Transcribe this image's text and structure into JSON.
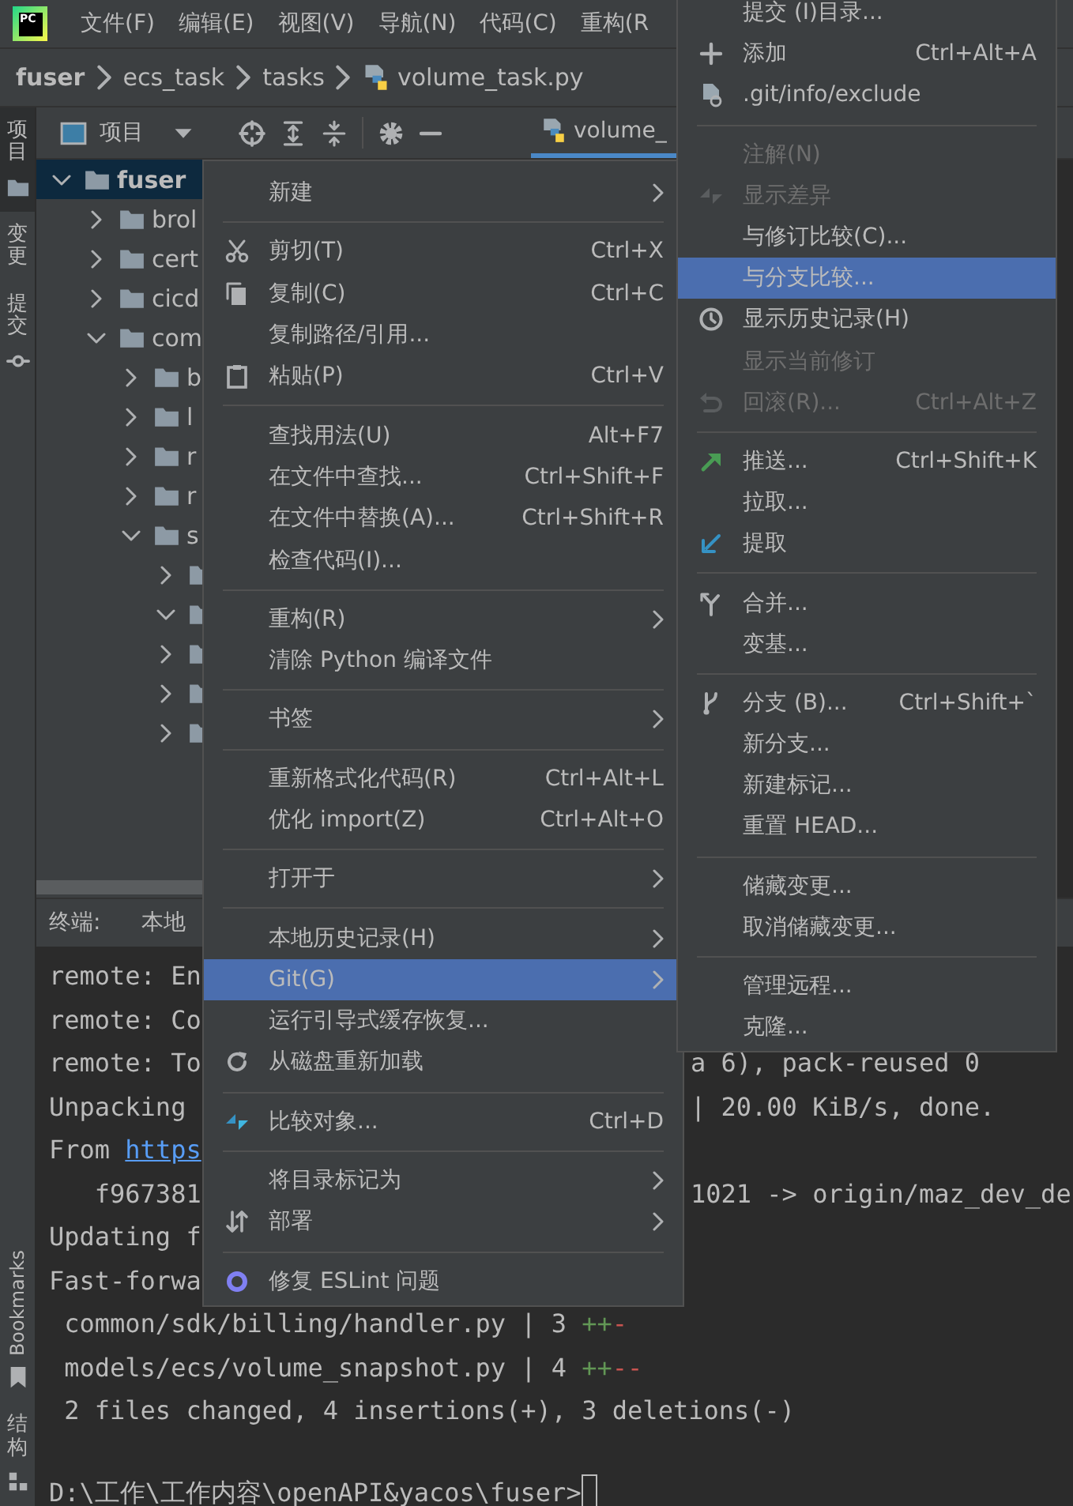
{
  "logo": "PC",
  "menu_bar": [
    "文件(F)",
    "编辑(E)",
    "视图(V)",
    "导航(N)",
    "代码(C)",
    "重构(R"
  ],
  "breadcrumb": [
    {
      "label": "fuser",
      "kind": "root"
    },
    {
      "label": "ecs_task",
      "kind": "folder"
    },
    {
      "label": "tasks",
      "kind": "folder"
    },
    {
      "label": "volume_task.py",
      "kind": "python"
    }
  ],
  "tool_strip": {
    "top": [
      {
        "label": "项目",
        "selected": true
      },
      {
        "label": "变更",
        "selected": false
      },
      {
        "label": "提交",
        "selected": false
      }
    ],
    "bottom": [
      {
        "label": "Bookmarks",
        "kind": "latin"
      },
      {
        "label": "结构",
        "kind": "cjk"
      }
    ]
  },
  "project_panel": {
    "title": "项目",
    "tree": [
      {
        "label": "fuser",
        "expanded": true,
        "selected": true,
        "children": [
          {
            "label": "brol",
            "expanded": false,
            "selected": false
          },
          {
            "label": "cert",
            "expanded": false,
            "selected": false
          },
          {
            "label": "cicd",
            "expanded": false,
            "selected": false
          },
          {
            "label": "com",
            "expanded": true,
            "selected": false,
            "children": [
              {
                "label": "b",
                "expanded": false,
                "selected": false
              },
              {
                "label": "l",
                "expanded": false,
                "selected": false
              },
              {
                "label": "r",
                "expanded": false,
                "selected": false
              },
              {
                "label": "r",
                "expanded": false,
                "selected": false
              },
              {
                "label": "s",
                "expanded": true,
                "selected": false,
                "children": [
                  {
                    "expanded": false,
                    "selected": false
                  },
                  {
                    "expanded": true,
                    "selected": false
                  },
                  {
                    "expanded": false,
                    "selected": false
                  },
                  {
                    "expanded": false,
                    "selected": false
                  },
                  {
                    "expanded": false,
                    "selected": false
                  }
                ]
              }
            ]
          }
        ]
      }
    ]
  },
  "editor_tab": {
    "label": "volume_",
    "selected": true
  },
  "terminal": {
    "title": "终端:",
    "tabs": [
      {
        "label": "本地"
      }
    ],
    "lines": [
      {
        "kind": "output",
        "text": "remote: En"
      },
      {
        "kind": "output",
        "text": "remote: Co"
      },
      {
        "kind": "output",
        "text": "remote: To",
        "right": "a 6), pack-reused 0"
      },
      {
        "kind": "output",
        "text": "Unpacking",
        "right": "| 20.00 KiB/s, done."
      },
      {
        "kind": "output",
        "text": "From ",
        "link": "https"
      },
      {
        "kind": "output",
        "text": "   f967381",
        "right": "1021 -> origin/maz_dev_de"
      },
      {
        "kind": "output",
        "text": "Updating f"
      },
      {
        "kind": "output",
        "text": "Fast-forwa"
      },
      {
        "kind": "output",
        "text": " common/sdk/billing/handler.py | 3 ",
        "plus": "++",
        "minus": "-"
      },
      {
        "kind": "output",
        "text": " models/ecs/volume_snapshot.py | 4 ",
        "plus": "++",
        "minus": "--"
      },
      {
        "kind": "output",
        "text": " 2 files changed, 4 insertions(+), 3 deletions(-)"
      },
      {
        "kind": "prompt",
        "text": "D:\\工作\\工作内容\\openAPI&yacos\\fuser>"
      }
    ]
  },
  "context_menu": {
    "items": [
      {
        "kind": "item",
        "label": "新建",
        "submenu": true,
        "selected": false
      },
      {
        "kind": "separator"
      },
      {
        "kind": "item",
        "label": "剪切(T)",
        "shortcut": "Ctrl+X",
        "selected": false
      },
      {
        "kind": "item",
        "label": "复制(C)",
        "shortcut": "Ctrl+C",
        "selected": false
      },
      {
        "kind": "item",
        "label": "复制路径/引用...",
        "selected": false
      },
      {
        "kind": "item",
        "label": "粘贴(P)",
        "shortcut": "Ctrl+V",
        "selected": false
      },
      {
        "kind": "separator"
      },
      {
        "kind": "item",
        "label": "查找用法(U)",
        "shortcut": "Alt+F7",
        "selected": false
      },
      {
        "kind": "item",
        "label": "在文件中查找...",
        "shortcut": "Ctrl+Shift+F",
        "selected": false
      },
      {
        "kind": "item",
        "label": "在文件中替换(A)...",
        "shortcut": "Ctrl+Shift+R",
        "selected": false
      },
      {
        "kind": "item",
        "label": "检查代码(I)...",
        "selected": false
      },
      {
        "kind": "separator"
      },
      {
        "kind": "item",
        "label": "重构(R)",
        "submenu": true,
        "selected": false
      },
      {
        "kind": "item",
        "label": "清除 Python 编译文件",
        "selected": false
      },
      {
        "kind": "separator"
      },
      {
        "kind": "item",
        "label": "书签",
        "submenu": true,
        "selected": false
      },
      {
        "kind": "separator"
      },
      {
        "kind": "item",
        "label": "重新格式化代码(R)",
        "shortcut": "Ctrl+Alt+L",
        "selected": false
      },
      {
        "kind": "item",
        "label": "优化 import(Z)",
        "shortcut": "Ctrl+Alt+O",
        "selected": false
      },
      {
        "kind": "separator"
      },
      {
        "kind": "item",
        "label": "打开于",
        "submenu": true,
        "selected": false
      },
      {
        "kind": "separator"
      },
      {
        "kind": "item",
        "label": "本地历史记录(H)",
        "submenu": true,
        "selected": false
      },
      {
        "kind": "item",
        "label": "Git(G)",
        "submenu": true,
        "selected": true
      },
      {
        "kind": "item",
        "label": "运行引导式缓存恢复...",
        "selected": false
      },
      {
        "kind": "item",
        "label": "从磁盘重新加载",
        "selected": false
      },
      {
        "kind": "separator"
      },
      {
        "kind": "item",
        "label": "比较对象...",
        "shortcut": "Ctrl+D",
        "selected": false
      },
      {
        "kind": "separator"
      },
      {
        "kind": "item",
        "label": "将目录标记为",
        "submenu": true,
        "selected": false
      },
      {
        "kind": "item",
        "label": "部署",
        "submenu": true,
        "selected": false
      },
      {
        "kind": "separator"
      },
      {
        "kind": "item",
        "label": "修复 ESLint 问题",
        "selected": false
      }
    ]
  },
  "git_submenu": {
    "items": [
      {
        "kind": "item",
        "label": "提交 (I)目录...",
        "selected": false,
        "disabled": false
      },
      {
        "kind": "item",
        "label": "添加",
        "shortcut": "Ctrl+Alt+A",
        "selected": false,
        "disabled": false
      },
      {
        "kind": "item",
        "label": ".git/info/exclude",
        "selected": false,
        "disabled": false
      },
      {
        "kind": "separator"
      },
      {
        "kind": "item",
        "label": "注解(N)",
        "selected": false,
        "disabled": true
      },
      {
        "kind": "item",
        "label": "显示差异",
        "selected": false,
        "disabled": true
      },
      {
        "kind": "item",
        "label": "与修订比较(C)...",
        "selected": false,
        "disabled": false
      },
      {
        "kind": "item",
        "label": "与分支比较...",
        "selected": true,
        "disabled": false
      },
      {
        "kind": "item",
        "label": "显示历史记录(H)",
        "selected": false,
        "disabled": false
      },
      {
        "kind": "item",
        "label": "显示当前修订",
        "selected": false,
        "disabled": true
      },
      {
        "kind": "item",
        "label": "回滚(R)...",
        "shortcut": "Ctrl+Alt+Z",
        "selected": false,
        "disabled": true
      },
      {
        "kind": "separator"
      },
      {
        "kind": "item",
        "label": "推送...",
        "shortcut": "Ctrl+Shift+K",
        "selected": false,
        "disabled": false
      },
      {
        "kind": "item",
        "label": "拉取...",
        "selected": false,
        "disabled": false
      },
      {
        "kind": "item",
        "label": "提取",
        "selected": false,
        "disabled": false
      },
      {
        "kind": "separator"
      },
      {
        "kind": "item",
        "label": "合并...",
        "selected": false,
        "disabled": false
      },
      {
        "kind": "item",
        "label": "变基...",
        "selected": false,
        "disabled": false
      },
      {
        "kind": "separator"
      },
      {
        "kind": "item",
        "label": "分支 (B)...",
        "shortcut": "Ctrl+Shift+`",
        "selected": false,
        "disabled": false
      },
      {
        "kind": "item",
        "label": "新分支...",
        "selected": false,
        "disabled": false
      },
      {
        "kind": "item",
        "label": "新建标记...",
        "selected": false,
        "disabled": false
      },
      {
        "kind": "item",
        "label": "重置 HEAD...",
        "selected": false,
        "disabled": false
      },
      {
        "kind": "separator"
      },
      {
        "kind": "item",
        "label": "储藏变更...",
        "selected": false,
        "disabled": false
      },
      {
        "kind": "item",
        "label": "取消储藏变更...",
        "selected": false,
        "disabled": false
      },
      {
        "kind": "separator"
      },
      {
        "kind": "item",
        "label": "管理远程...",
        "selected": false,
        "disabled": false
      },
      {
        "kind": "item",
        "label": "克隆...",
        "selected": false,
        "disabled": false
      }
    ]
  }
}
